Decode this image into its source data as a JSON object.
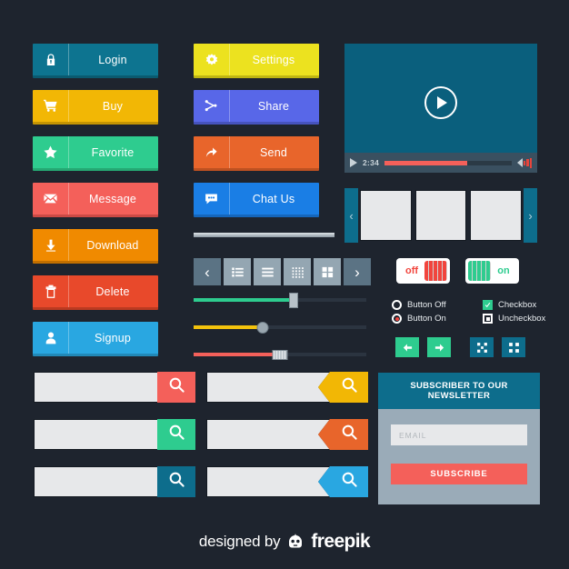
{
  "page": {
    "background": "#1e242e",
    "footer": {
      "prefix": "designed by",
      "brand": "freepik",
      "logo_icon": "freepik-robot-icon"
    }
  },
  "action_buttons_left": [
    {
      "label": "Login",
      "icon": "lock-icon",
      "color": "#0d7490",
      "shadow": "#0a5a70"
    },
    {
      "label": "Buy",
      "icon": "cart-icon",
      "color": "#f2b705",
      "shadow": "#c49403"
    },
    {
      "label": "Favorite",
      "icon": "star-icon",
      "color": "#2ecc8f",
      "shadow": "#25a873"
    },
    {
      "label": "Message",
      "icon": "envelope-icon",
      "color": "#f4605a",
      "shadow": "#cc4a45"
    },
    {
      "label": "Download",
      "icon": "download-icon",
      "color": "#f08a00",
      "shadow": "#c26f00"
    },
    {
      "label": "Delete",
      "icon": "trash-icon",
      "color": "#e8492b",
      "shadow": "#bb3a21"
    },
    {
      "label": "Signup",
      "icon": "user-icon",
      "color": "#29a7e1",
      "shadow": "#2189b8"
    }
  ],
  "action_buttons_mid": [
    {
      "label": "Settings",
      "icon": "gear-icon",
      "color": "#ece21f",
      "shadow": "#bfb612"
    },
    {
      "label": "Share",
      "icon": "share-icon",
      "color": "#5867e8",
      "shadow": "#4653bd"
    },
    {
      "label": "Send",
      "icon": "send-arrow-icon",
      "color": "#e8652b",
      "shadow": "#bd5121"
    },
    {
      "label": "Chat Us",
      "icon": "chat-icon",
      "color": "#1a7ee5",
      "shadow": "#1566bb"
    }
  ],
  "video": {
    "play_icon": "play-circle-icon",
    "control_play_icon": "play-icon",
    "time": "2:34",
    "progress_percent": 65,
    "progress_color": "#f4605a",
    "volume_icon": "volume-icon",
    "screen_color": "#0a5f7d",
    "bar_color": "#3a5060"
  },
  "carousel": {
    "prev_icon": "chevron-left-icon",
    "next_icon": "chevron-right-icon",
    "arrow_color": "#0d6d8c",
    "slides": [
      "slide-1",
      "slide-2",
      "slide-3"
    ]
  },
  "toolbar": {
    "items": [
      {
        "icon": "chevron-left-icon",
        "style": "dark"
      },
      {
        "icon": "list-bullets-icon",
        "style": "light"
      },
      {
        "icon": "list-lines-icon",
        "style": "light"
      },
      {
        "icon": "grid-dots-icon",
        "style": "light"
      },
      {
        "icon": "grid-squares-icon",
        "style": "light"
      },
      {
        "icon": "chevron-right-icon",
        "style": "dark"
      }
    ]
  },
  "sliders": [
    {
      "name": "green-slider",
      "value": 58,
      "color": "#2ecc8f",
      "handle": "rect"
    },
    {
      "name": "yellow-slider",
      "value": 40,
      "color": "#f2c20c",
      "handle": "round"
    },
    {
      "name": "red-slider",
      "value": 50,
      "color": "#f4605a",
      "handle": "grip"
    }
  ],
  "toggles": [
    {
      "name": "toggle-off",
      "label": "off",
      "state": "off",
      "color": "#f1453d"
    },
    {
      "name": "toggle-on",
      "label": "on",
      "state": "on",
      "color": "#2ecc8f"
    }
  ],
  "options": {
    "radio_off": {
      "label": "Button Off",
      "checked": false
    },
    "radio_on": {
      "label": "Button On",
      "checked": true
    },
    "check_on": {
      "label": "Checkbox",
      "checked": true
    },
    "check_off": {
      "label": "Uncheckbox",
      "checked": false
    }
  },
  "mini_buttons": [
    {
      "name": "arrow-left-button",
      "icon": "arrow-left-icon",
      "color": "#2ecc8f"
    },
    {
      "name": "arrow-right-button",
      "icon": "arrow-right-icon",
      "color": "#2ecc8f"
    },
    {
      "name": "expand-button",
      "icon": "expand-icon",
      "color": "#0d6d8c"
    },
    {
      "name": "collapse-button",
      "icon": "collapse-icon",
      "color": "#0d6d8c"
    }
  ],
  "search_bars_left": [
    {
      "name": "search-red",
      "icon": "search-icon",
      "color": "#f4605a",
      "value": "",
      "placeholder": ""
    },
    {
      "name": "search-green",
      "icon": "search-icon",
      "color": "#2ecc8f",
      "value": "",
      "placeholder": ""
    },
    {
      "name": "search-teal",
      "icon": "search-icon",
      "color": "#0d6d8c",
      "value": "",
      "placeholder": ""
    }
  ],
  "search_bars_notched": [
    {
      "name": "search-yellow",
      "icon": "search-icon",
      "color": "#f2b705",
      "value": "",
      "placeholder": ""
    },
    {
      "name": "search-orange",
      "icon": "search-icon",
      "color": "#e8652b",
      "value": "",
      "placeholder": ""
    },
    {
      "name": "search-blue",
      "icon": "search-icon",
      "color": "#29a7e1",
      "value": "",
      "placeholder": ""
    }
  ],
  "newsletter": {
    "title": "SUBSCRIBER TO OUR NEWSLETTER",
    "email_placeholder": "EMAIL",
    "email_value": "",
    "submit_label": "SUBSCRIBE",
    "header_color": "#0d6d8c",
    "panel_color": "#9aabb8",
    "submit_color": "#f4605a"
  }
}
